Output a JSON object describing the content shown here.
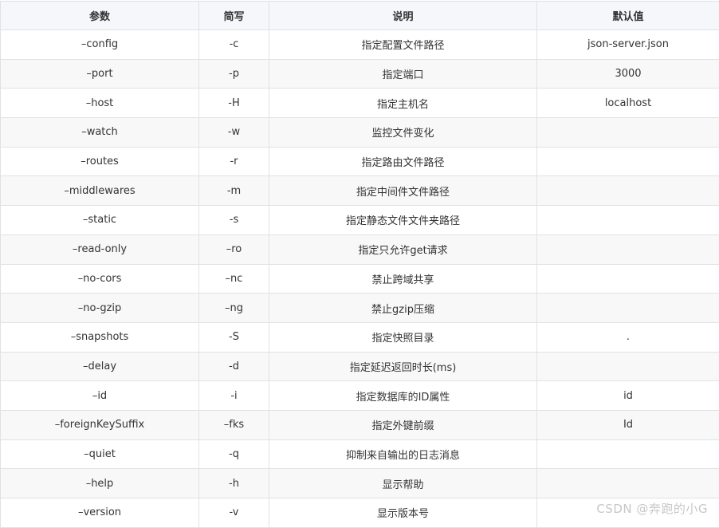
{
  "table": {
    "headers": [
      "参数",
      "简写",
      "说明",
      "默认值"
    ],
    "rows": [
      [
        "–config",
        "-c",
        "指定配置文件路径",
        "json-server.json"
      ],
      [
        "–port",
        "-p",
        "指定端口",
        "3000"
      ],
      [
        "–host",
        "-H",
        "指定主机名",
        "localhost"
      ],
      [
        "–watch",
        "-w",
        "监控文件变化",
        ""
      ],
      [
        "–routes",
        "-r",
        "指定路由文件路径",
        ""
      ],
      [
        "–middlewares",
        "-m",
        "指定中间件文件路径",
        ""
      ],
      [
        "–static",
        "-s",
        "指定静态文件文件夹路径",
        ""
      ],
      [
        "–read-only",
        "–ro",
        "指定只允许get请求",
        ""
      ],
      [
        "–no-cors",
        "–nc",
        "禁止跨域共享",
        ""
      ],
      [
        "–no-gzip",
        "–ng",
        "禁止gzip压缩",
        ""
      ],
      [
        "–snapshots",
        "-S",
        "指定快照目录",
        "."
      ],
      [
        "–delay",
        "-d",
        "指定延迟返回时长(ms)",
        ""
      ],
      [
        "–id",
        "-i",
        "指定数据库的ID属性",
        "id"
      ],
      [
        "–foreignKeySuffix",
        "–fks",
        "指定外键前缀",
        "Id"
      ],
      [
        "–quiet",
        "-q",
        "抑制来自输出的日志消息",
        ""
      ],
      [
        "–help",
        "-h",
        "显示帮助",
        ""
      ],
      [
        "–version",
        "-v",
        "显示版本号",
        ""
      ]
    ]
  },
  "watermark": "CSDN @奔跑的小G"
}
